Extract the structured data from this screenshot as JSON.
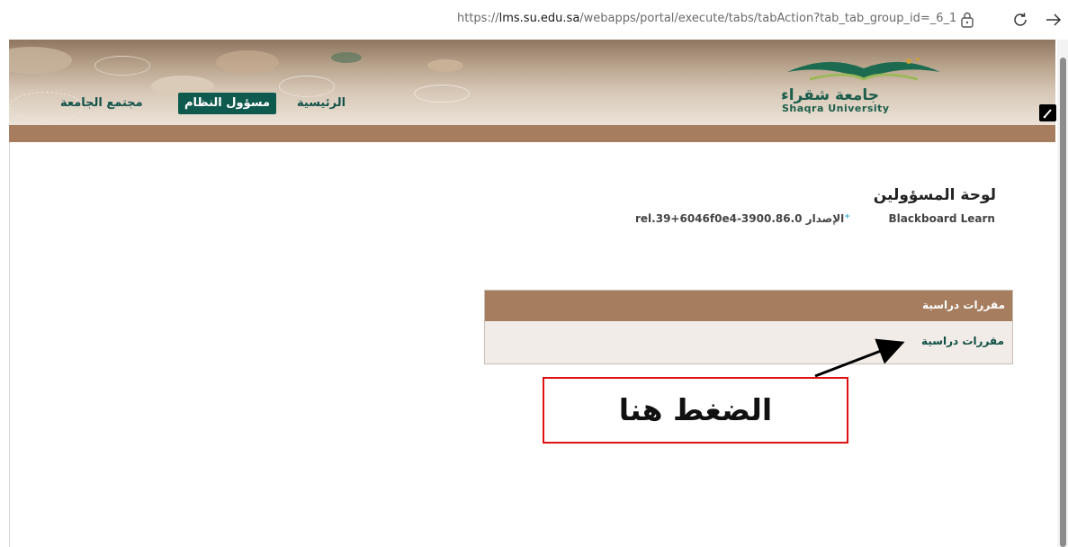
{
  "browser": {
    "url_prefix": "https://",
    "url_host": "lms.su.edu.sa",
    "url_path": "/webapps/portal/execute/tabs/tabAction?tab_tab_group_id=_6_1"
  },
  "header": {
    "logo": {
      "arabic": "جامعة شقراء",
      "english": "Shaqra University"
    },
    "tabs": [
      {
        "label": "الرئيسية",
        "active": false
      },
      {
        "label": "مسؤول النظام",
        "active": true
      },
      {
        "label": "مجتمع الجامعة",
        "active": false
      }
    ]
  },
  "main": {
    "title": "لوحة المسؤولين",
    "product": "Blackboard Learn",
    "version_label": "الإصدار",
    "version_value": "rel.39+6046f0e4-3900.86.0",
    "module": {
      "title": "مقررات دراسية",
      "link": "مقررات دراسية"
    }
  },
  "annotation": {
    "callout_text": "الضغط هنا",
    "color": "#e01010"
  },
  "colors": {
    "brand_green": "#0f5a4e",
    "brand_brown": "#a67d5e"
  }
}
